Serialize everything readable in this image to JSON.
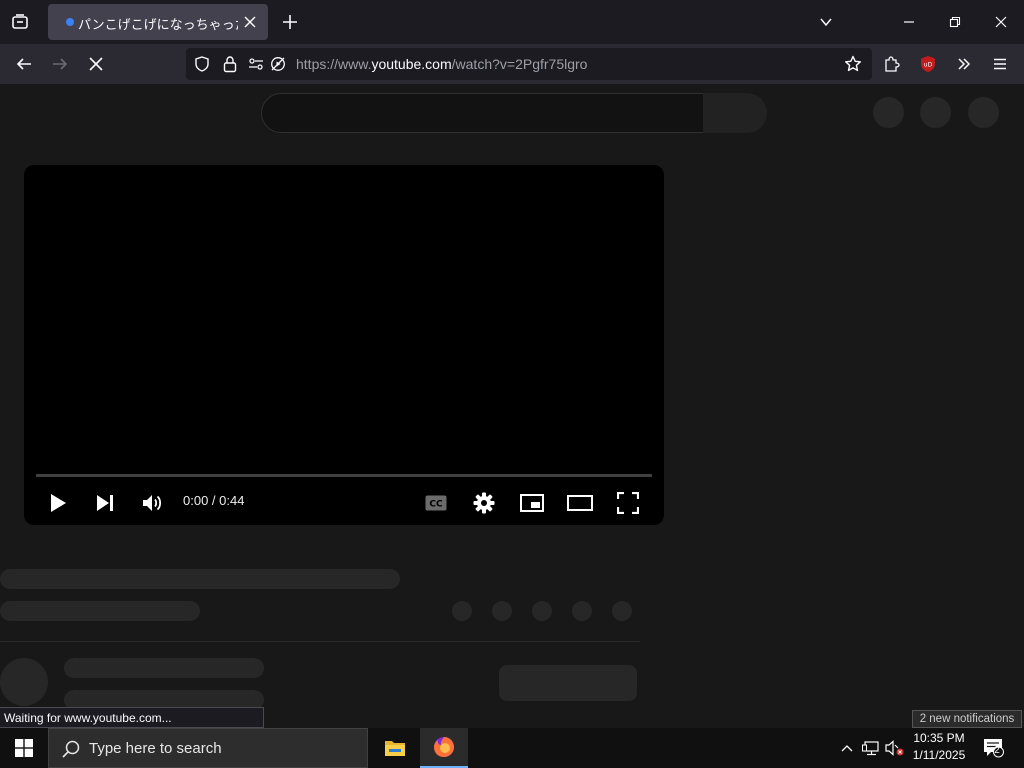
{
  "browser": {
    "tab": {
      "title": "パンこげこげになっちゃった(!"
    },
    "address_bar": {
      "url_prefix": "https://www.",
      "url_domain": "youtube.com",
      "url_path": "/watch?v=2Pgfr75lgro"
    },
    "status_text": "Waiting for www.youtube.com..."
  },
  "player": {
    "time": "0:00 / 0:44"
  },
  "taskbar": {
    "search_placeholder": "Type here to search",
    "time": "10:35 PM",
    "date": "1/11/2025",
    "notification_count": "2",
    "notification_tooltip": "2 new notifications"
  },
  "colors": {
    "page_bg": "#181818",
    "skeleton": "#272727",
    "ublock_red": "#c41c1c",
    "firefox_orange": "#ff7139",
    "tab_active_bg": "#42414d"
  }
}
